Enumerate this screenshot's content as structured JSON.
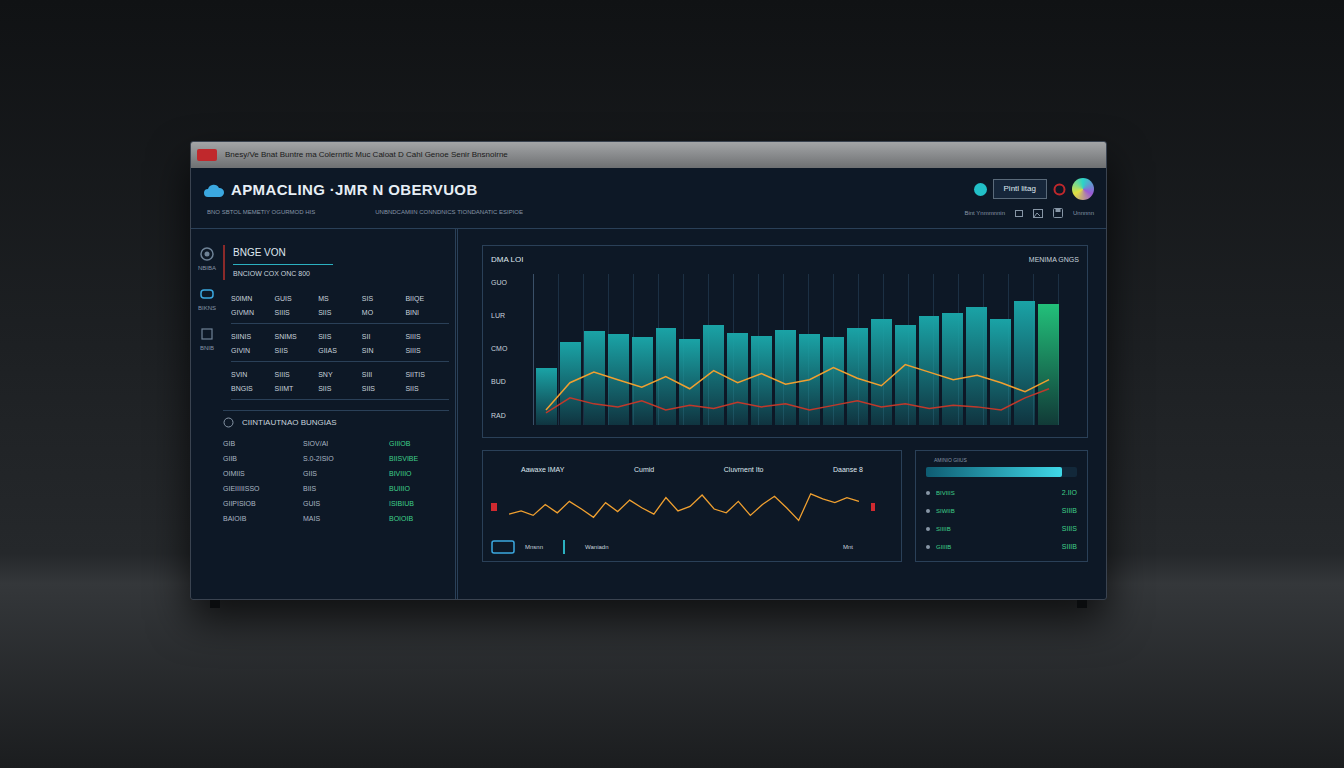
{
  "window": {
    "title": "Bnesy/Ve  Bnat Buntre  ma  Colernrtic  Muc  Caloat D  Cahl Genoe  Senir Bnsnoirne"
  },
  "header": {
    "title": "APMACLING ·JMR N OBERVUOB",
    "subtitle": "BNO  SBTOL MEMETIY  OGURMOD HIS",
    "note": "UNBNDCAMIIN CONNDNICS TIONDANATIC ESIPIOE",
    "button": "Pintl litag",
    "links": [
      "Bint Ynmmnnin",
      "Unnnnn"
    ]
  },
  "sidebar": {
    "items": [
      {
        "label": "NBIBA"
      },
      {
        "label": "BIKNS"
      },
      {
        "label": "BNIB"
      }
    ]
  },
  "overview": {
    "title": "BNGE VON",
    "subtitle": "BNCIOW COX ONC 800",
    "rows": [
      [
        "S0IMN",
        "GUIS",
        "MS",
        "SIS",
        "BIIQE"
      ],
      [
        "GIVMN",
        "SIIIS",
        "SIIS",
        "MO",
        "BINI"
      ],
      [
        "SIINIS",
        "SNIMS",
        "SIIS",
        "SII",
        "SIIIS"
      ],
      [
        "GIVIN",
        "SIIS",
        "GIIAS",
        "SIN",
        "SIIIS"
      ],
      [
        "SVIN",
        "SIIIS",
        "SNY",
        "SIII",
        "SIITIS"
      ],
      [
        "BNGIS",
        "SIIMT",
        "SIIS",
        "SIIS",
        "SIIS"
      ]
    ]
  },
  "customers": {
    "title": "CIINTIAUTNAO BUNGIAS",
    "rows": [
      [
        "GIB",
        "SIOV/AI",
        "GIIIOB"
      ],
      [
        "GIIB",
        "S.0-2ISIO",
        "BIISVIBE"
      ],
      [
        "OIMIIS",
        "GIIS",
        "BIVIIIO"
      ],
      [
        "GIEIIIIISSO",
        "BIIS",
        "BUIIIO"
      ],
      [
        "GIIPISIOB",
        "GUIS",
        "ISIBIUB"
      ],
      [
        "BAIOIB",
        "MAIS",
        "BOIOIB"
      ]
    ]
  },
  "chart": {
    "title": "DMA LOI",
    "legend": "MENIMA GNGS",
    "y_ticks": [
      "GUO",
      "LUR",
      "CMO",
      "BUD",
      "RAD"
    ],
    "series": [
      {
        "kind": "bar",
        "color": "#1aa3a6",
        "highlight_color": "#22c07a",
        "highlight_index": 21,
        "values": [
          38,
          55,
          62,
          60,
          58,
          64,
          57,
          66,
          61,
          59,
          63,
          60,
          58,
          64,
          70,
          66,
          72,
          74,
          78,
          70,
          82,
          80
        ]
      },
      {
        "kind": "line",
        "color": "#f0a030",
        "values": [
          10,
          28,
          35,
          30,
          25,
          32,
          24,
          36,
          28,
          34,
          27,
          30,
          38,
          31,
          26,
          40,
          35,
          30,
          33,
          28,
          22,
          30
        ]
      },
      {
        "kind": "line",
        "color": "#c0392b",
        "values": [
          8,
          18,
          14,
          12,
          16,
          10,
          13,
          11,
          15,
          12,
          14,
          10,
          13,
          16,
          12,
          14,
          11,
          13,
          12,
          10,
          18,
          24
        ]
      }
    ]
  },
  "trend": {
    "labels": [
      "Aawaxe IMAY",
      "Cumid",
      "Cluvrnent Ito",
      "Daanse 8"
    ],
    "series": [
      {
        "kind": "line",
        "color": "#f0a030",
        "values": [
          40,
          45,
          38,
          55,
          42,
          60,
          48,
          35,
          58,
          44,
          62,
          50,
          40,
          66,
          45,
          52,
          70,
          48,
          42,
          60,
          38,
          55,
          68,
          50,
          30,
          72,
          64,
          58,
          66,
          60
        ]
      }
    ],
    "footer": [
      "Mnsnn",
      "Waniadn",
      "Mnt"
    ]
  },
  "side": {
    "bar": {
      "label": "AMINIO GIIUS",
      "level": 0.9
    },
    "rows": [
      {
        "label": "BIVIIIS",
        "value": "2.IIO"
      },
      {
        "label": "SIWIIB",
        "value": "SIIIB"
      },
      {
        "label": "SIIIIB",
        "value": "SIIIS"
      },
      {
        "label": "GIIIIB",
        "value": "SIIIB"
      }
    ]
  }
}
